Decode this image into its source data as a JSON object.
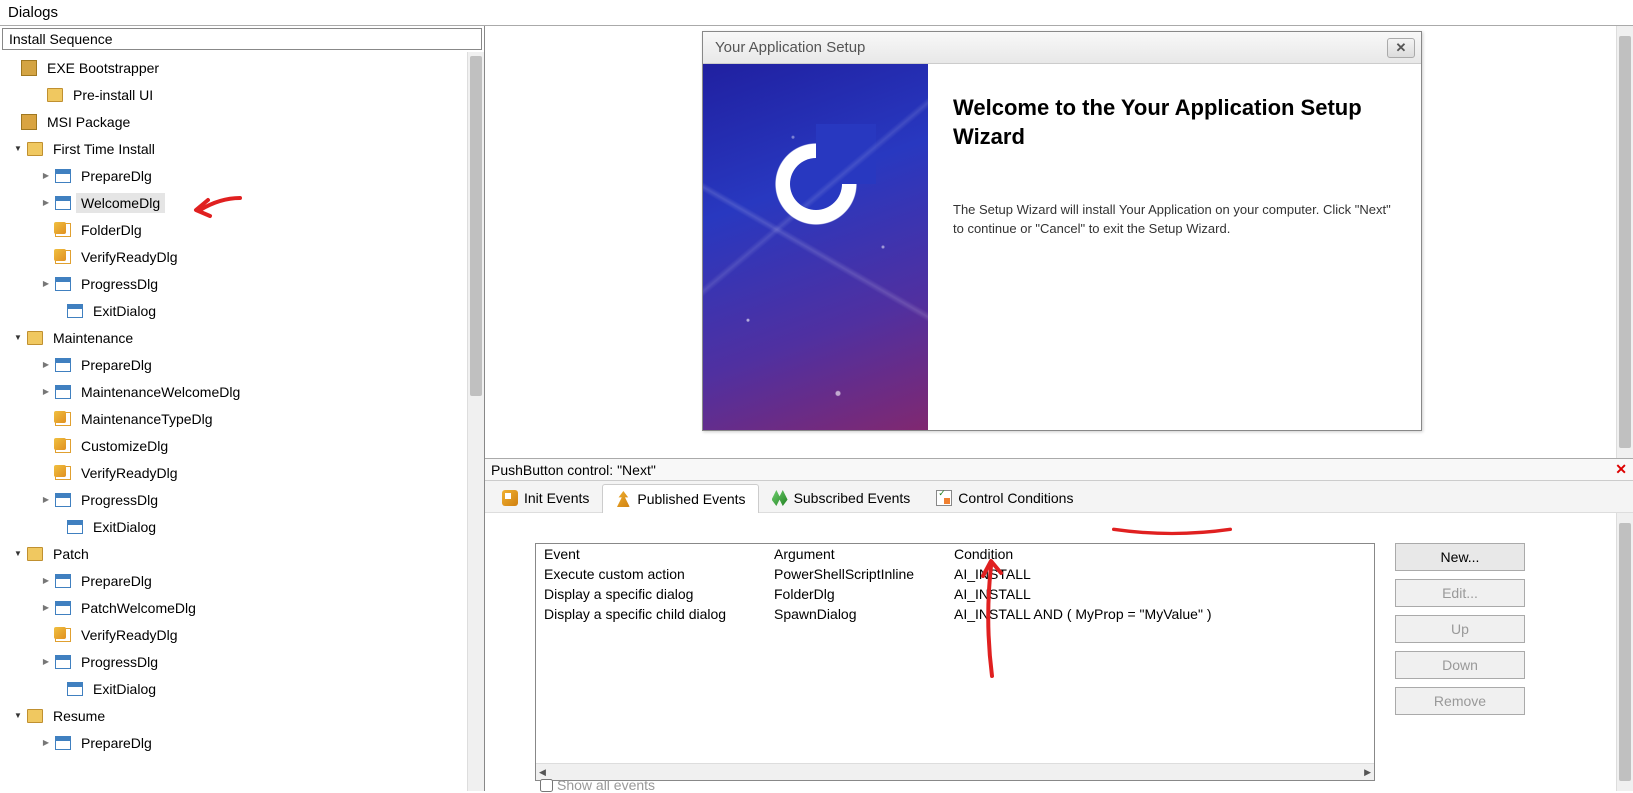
{
  "header": "Dialogs",
  "installSequenceLabel": "Install Sequence",
  "tree": {
    "exeBootstrapper": "EXE Bootstrapper",
    "preInstallUI": "Pre-install UI",
    "msiPackage": "MSI Package",
    "firstTimeInstall": "First Time Install",
    "prepareDlg": "PrepareDlg",
    "welcomeDlg": "WelcomeDlg",
    "folderDlg": "FolderDlg",
    "verifyReadyDlg": "VerifyReadyDlg",
    "progressDlg": "ProgressDlg",
    "exitDialog": "ExitDialog",
    "maintenance": "Maintenance",
    "maintenanceWelcomeDlg": "MaintenanceWelcomeDlg",
    "maintenanceTypeDlg": "MaintenanceTypeDlg",
    "customizeDlg": "CustomizeDlg",
    "patch": "Patch",
    "patchWelcomeDlg": "PatchWelcomeDlg",
    "resume": "Resume"
  },
  "preview": {
    "title": "Your Application Setup",
    "heading": "Welcome to the Your Application Setup Wizard",
    "body": "The Setup Wizard will install Your Application on your computer.  Click \"Next\" to continue or \"Cancel\" to exit the Setup Wizard."
  },
  "detail": {
    "header": "PushButton control: \"Next\"",
    "tabs": {
      "init": "Init Events",
      "published": "Published Events",
      "subscribed": "Subscribed Events",
      "conditions": "Control Conditions"
    },
    "columns": {
      "event": "Event",
      "argument": "Argument",
      "condition": "Condition"
    },
    "rows": [
      {
        "event": "Execute custom action",
        "argument": "PowerShellScriptInline",
        "condition": "AI_INSTALL"
      },
      {
        "event": "Display a specific dialog",
        "argument": "FolderDlg",
        "condition": "AI_INSTALL"
      },
      {
        "event": "Display a specific child dialog",
        "argument": "SpawnDialog",
        "condition": "AI_INSTALL AND ( MyProp = \"MyValue\" )"
      }
    ],
    "buttons": {
      "new": "New...",
      "edit": "Edit...",
      "up": "Up",
      "down": "Down",
      "remove": "Remove"
    },
    "showAll": "Show all events"
  }
}
